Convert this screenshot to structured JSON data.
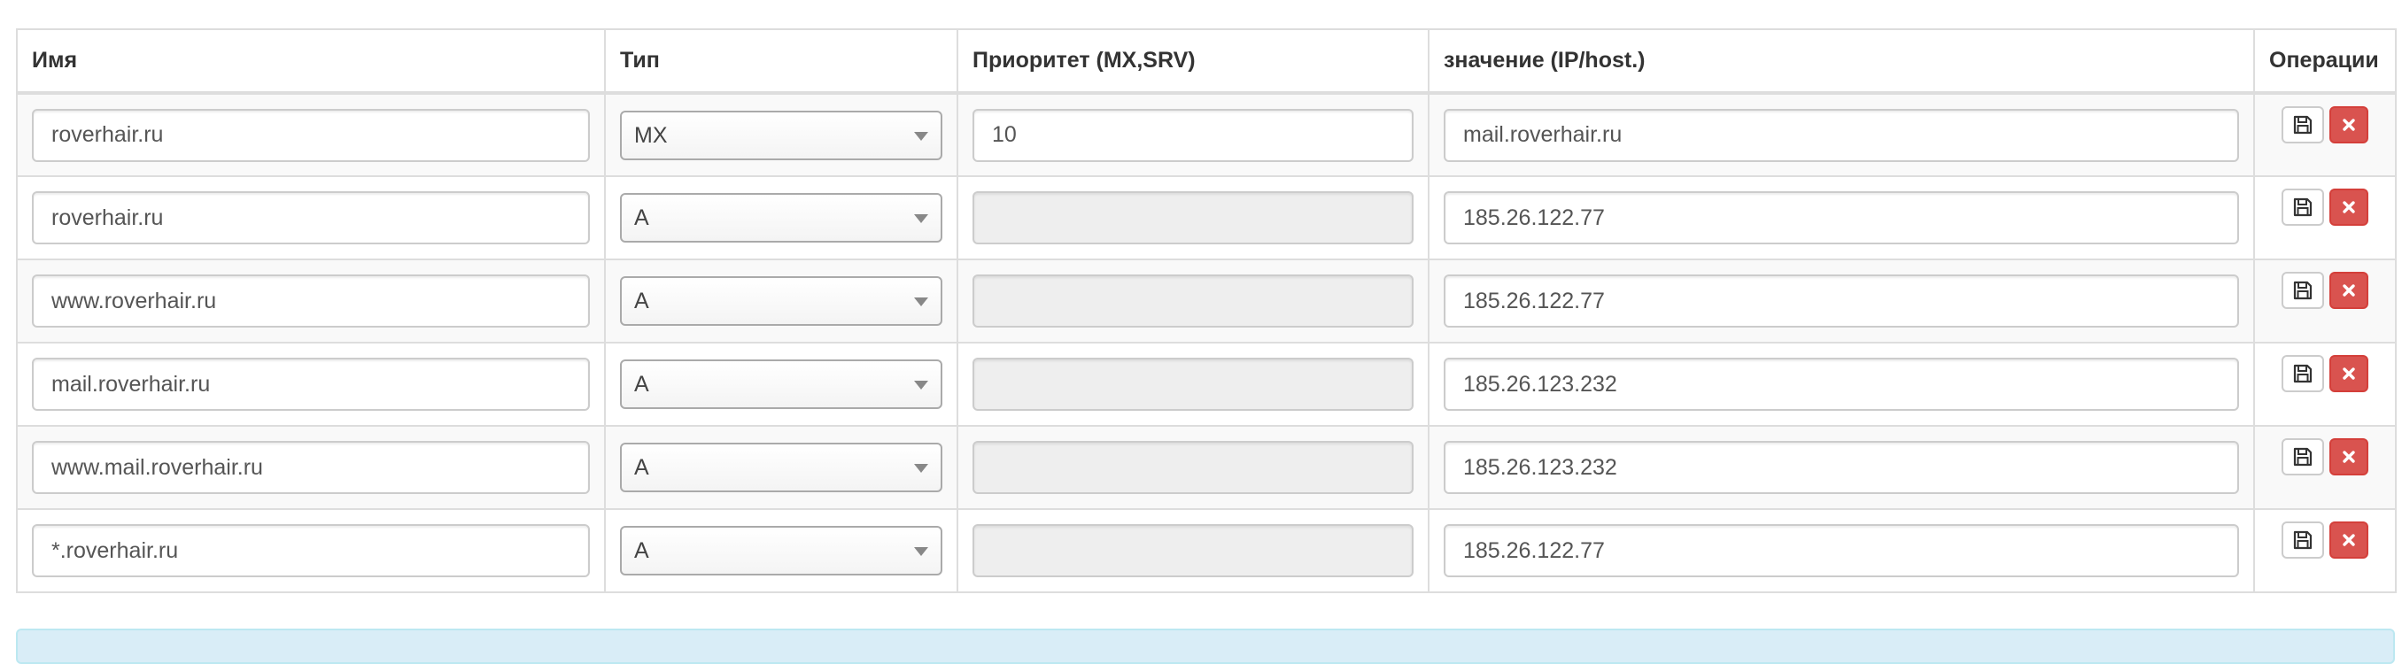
{
  "table": {
    "headers": {
      "name": "Имя",
      "type": "Тип",
      "priority": "Приоритет (MX,SRV)",
      "value": "значение (IP/host.)",
      "ops": "Операции"
    },
    "rows": [
      {
        "name": "roverhair.ru",
        "type": "MX",
        "priority": "10",
        "value": "mail.roverhair.ru"
      },
      {
        "name": "roverhair.ru",
        "type": "A",
        "priority": "",
        "value": "185.26.122.77"
      },
      {
        "name": "www.roverhair.ru",
        "type": "A",
        "priority": "",
        "value": "185.26.122.77"
      },
      {
        "name": "mail.roverhair.ru",
        "type": "A",
        "priority": "",
        "value": "185.26.123.232"
      },
      {
        "name": "www.mail.roverhair.ru",
        "type": "A",
        "priority": "",
        "value": "185.26.123.232"
      },
      {
        "name": "*.roverhair.ru",
        "type": "A",
        "priority": "",
        "value": "185.26.122.77"
      }
    ]
  },
  "icons": {
    "save": "floppy-disk-icon",
    "delete": "close-icon",
    "select_caret": "caret-down-icon"
  },
  "colors": {
    "delete_button": "#d9534f",
    "info_bar": "#d9edf7",
    "disabled_input": "#eeeeee",
    "row_stripe": "#f9f9f9"
  }
}
